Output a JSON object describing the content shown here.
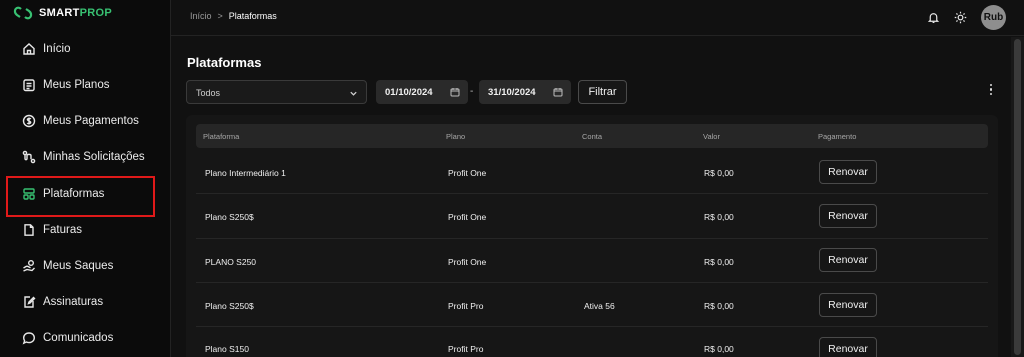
{
  "app": {
    "logo_text": "SMART",
    "logo_accent": "PROP"
  },
  "sidebar": {
    "items": [
      {
        "label": "Início",
        "icon": "home-icon"
      },
      {
        "label": "Meus Planos",
        "icon": "clipboard-icon"
      },
      {
        "label": "Meus Pagamentos",
        "icon": "dollar-icon"
      },
      {
        "label": "Minhas Solicitações",
        "icon": "route-icon"
      },
      {
        "label": "Plataformas",
        "icon": "grid-icon"
      },
      {
        "label": "Faturas",
        "icon": "file-icon"
      },
      {
        "label": "Meus Saques",
        "icon": "hand-coin-icon"
      },
      {
        "label": "Assinaturas",
        "icon": "pen-document-icon"
      },
      {
        "label": "Comunicados",
        "icon": "chat-bubble-icon"
      }
    ]
  },
  "breadcrumb": {
    "parent": "Início",
    "separator": ">",
    "current": "Plataformas"
  },
  "header": {
    "avatar_initials": "Rub"
  },
  "page": {
    "title": "Plataformas"
  },
  "filters": {
    "select_value": "Todos",
    "date_from": "01/10/2024",
    "date_to": "31/10/2024",
    "range_separator": "-",
    "filter_button": "Filtrar"
  },
  "table": {
    "headers": [
      "Plataforma",
      "Plano",
      "Conta",
      "Valor",
      "Pagamento"
    ],
    "rows": [
      {
        "plataforma": "Plano Intermediário 1",
        "plano": "Profit One",
        "conta": "",
        "valor": "R$ 0,00",
        "acao": "Renovar"
      },
      {
        "plataforma": "Plano S250$",
        "plano": "Profit One",
        "conta": "",
        "valor": "R$ 0,00",
        "acao": "Renovar"
      },
      {
        "plataforma": "PLANO S250",
        "plano": "Profit One",
        "conta": "",
        "valor": "R$ 0,00",
        "acao": "Renovar"
      },
      {
        "plataforma": "Plano S250$",
        "plano": "Profit Pro",
        "conta": "Ativa 56",
        "valor": "R$ 0,00",
        "acao": "Renovar"
      },
      {
        "plataforma": "Plano S150",
        "plano": "Profit Pro",
        "conta": "",
        "valor": "R$ 0,00",
        "acao": "Renovar"
      }
    ]
  },
  "colors": {
    "accent": "#38c172",
    "highlight": "#e01919",
    "background": "#111111"
  }
}
